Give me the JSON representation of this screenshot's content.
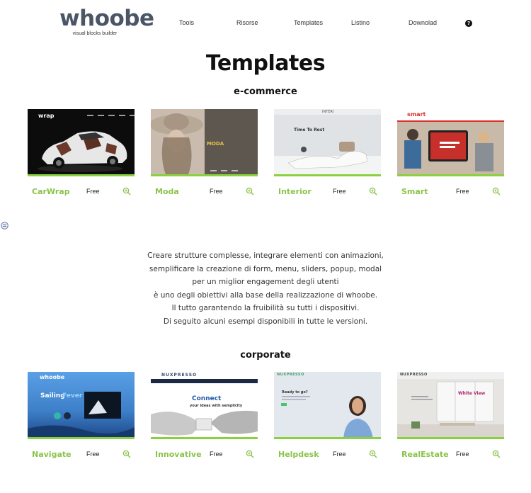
{
  "header": {
    "logo": "whoobe",
    "tagline": "visual blocks builder",
    "nav": [
      "Tools",
      "Risorse",
      "Templates",
      "Listino",
      "Downolad"
    ],
    "help_icon": "question-circle-icon"
  },
  "page": {
    "title": "Templates"
  },
  "ecommerce": {
    "title": "e-commerce",
    "cards": [
      {
        "name": "CarWrap",
        "price": "Free",
        "thumb_text": "wrap"
      },
      {
        "name": "Moda",
        "price": "Free",
        "thumb_text": "MODA"
      },
      {
        "name": "Interior",
        "price": "Free",
        "thumb_text": "Time To Rest",
        "thumb_brand": "INTERI"
      },
      {
        "name": "Smart",
        "price": "Free",
        "thumb_text": "smart"
      }
    ]
  },
  "description": {
    "lines": [
      "Creare strutture complesse, integrare elementi con animazioni,",
      "semplificare la creazione di form, menu, sliders, popup, modal",
      "per un miglior engagement degli utenti",
      "è uno degli obiettivi alla base della realizzazione di whoobe.",
      "Il tutto garantendo la fruibilità su tutti i dispositivi.",
      "Di seguito alcuni esempi disponibili in tutte le versioni."
    ]
  },
  "corporate": {
    "title": "corporate",
    "cards": [
      {
        "name": "Navigate",
        "price": "Free",
        "thumb_brand": "whoobe",
        "thumb_text_a": "Sailing",
        "thumb_text_b": "Fever"
      },
      {
        "name": "Innovative",
        "price": "Free",
        "thumb_brand": "NUXPRESSO",
        "thumb_text": "Connect",
        "thumb_sub": "your ideas with semplicity"
      },
      {
        "name": "Helpdesk",
        "price": "Free",
        "thumb_brand": "NUXPRESSO",
        "thumb_text": "Ready to go?"
      },
      {
        "name": "RealEstate",
        "price": "Free",
        "thumb_brand": "NUXPRESSO",
        "thumb_text": "White View"
      }
    ]
  },
  "colors": {
    "accent": "#8bc34a",
    "logo": "#4a5566"
  },
  "icons": {
    "zoom": "zoom-in-icon",
    "side": "chat-icon"
  }
}
